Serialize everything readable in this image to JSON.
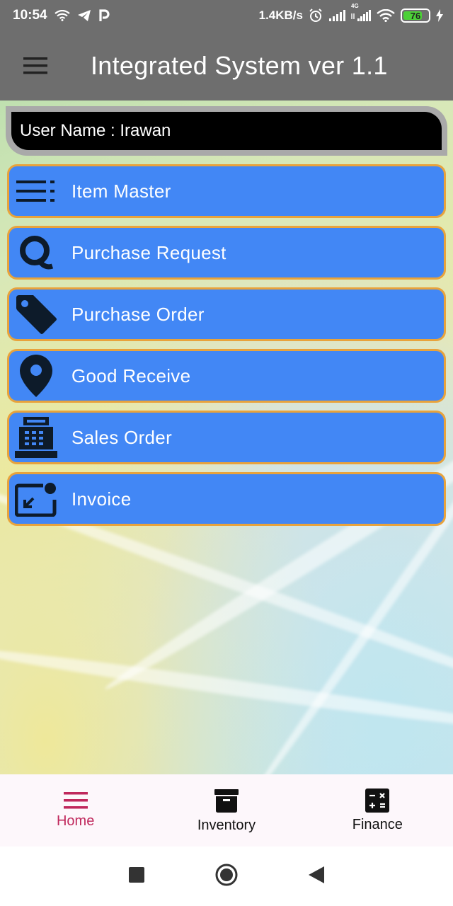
{
  "status_bar": {
    "time": "10:54",
    "net_speed": "1.4KB/s",
    "network_label": "4G",
    "battery": "76"
  },
  "app_bar": {
    "title": "Integrated System ver 1.1",
    "menu_icon": "hamburger-icon"
  },
  "user": {
    "label": "User Name : Irawan"
  },
  "menu": [
    {
      "label": "Item Master",
      "icon": "list-icon"
    },
    {
      "label": "Purchase Request",
      "icon": "q-letter-icon"
    },
    {
      "label": "Purchase Order",
      "icon": "tag-icon"
    },
    {
      "label": "Good Receive",
      "icon": "location-pin-icon"
    },
    {
      "label": "Sales Order",
      "icon": "cash-register-icon"
    },
    {
      "label": "Invoice",
      "icon": "picture-in-picture-icon"
    }
  ],
  "bottom_nav": [
    {
      "label": "Home",
      "icon": "menu-icon",
      "active": true
    },
    {
      "label": "Inventory",
      "icon": "archive-icon",
      "active": false
    },
    {
      "label": "Finance",
      "icon": "calculator-icon",
      "active": false
    }
  ],
  "colors": {
    "app_bar": "#6e6e6e",
    "menu_item": "#4287f5",
    "menu_border": "#e8a33c",
    "active_nav": "#c0285c"
  }
}
